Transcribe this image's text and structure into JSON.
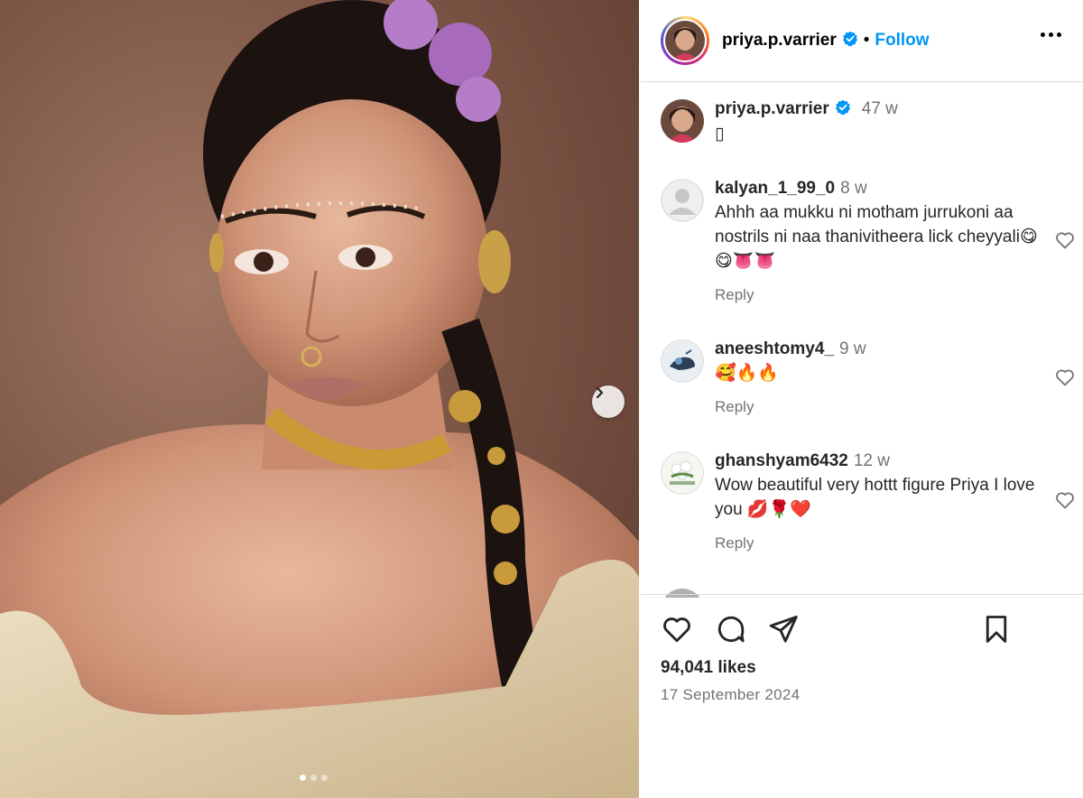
{
  "post": {
    "author": "priya.p.varrier",
    "verified": true,
    "follow_label": "Follow",
    "separator": "•",
    "caption": {
      "username": "priya.p.varrier",
      "time": "47 w",
      "text": "▯"
    },
    "carousel": {
      "current": 1,
      "total": 3
    },
    "likes": "94,041 likes",
    "date": "17 September 2024"
  },
  "comments": [
    {
      "username": "kalyan_1_99_0",
      "time": "8 w",
      "text": "Ahhh aa mukku ni motham jurrukoni aa nostrils ni naa thanivitheera lick cheyyali😋😋👅👅",
      "reply_label": "Reply",
      "avatar": "default-avatar-icon"
    },
    {
      "username": "aneeshtomy4_",
      "time": "9 w",
      "text": "🥰🔥🔥",
      "reply_label": "Reply",
      "avatar": "photo-avatar"
    },
    {
      "username": "ghanshyam6432",
      "time": "12 w",
      "text": "Wow beautiful very hottt figure Priya I love you 💋🌹❤️",
      "reply_label": "Reply",
      "avatar": "flowers-avatar"
    }
  ],
  "icons": {
    "like": "heart-icon",
    "comment": "comment-icon",
    "share": "share-icon",
    "save": "bookmark-icon",
    "more": "more-options-icon",
    "next": "chevron-right-icon"
  },
  "colors": {
    "follow": "#0095f6",
    "verified": "#0095f6",
    "muted": "#737373"
  }
}
